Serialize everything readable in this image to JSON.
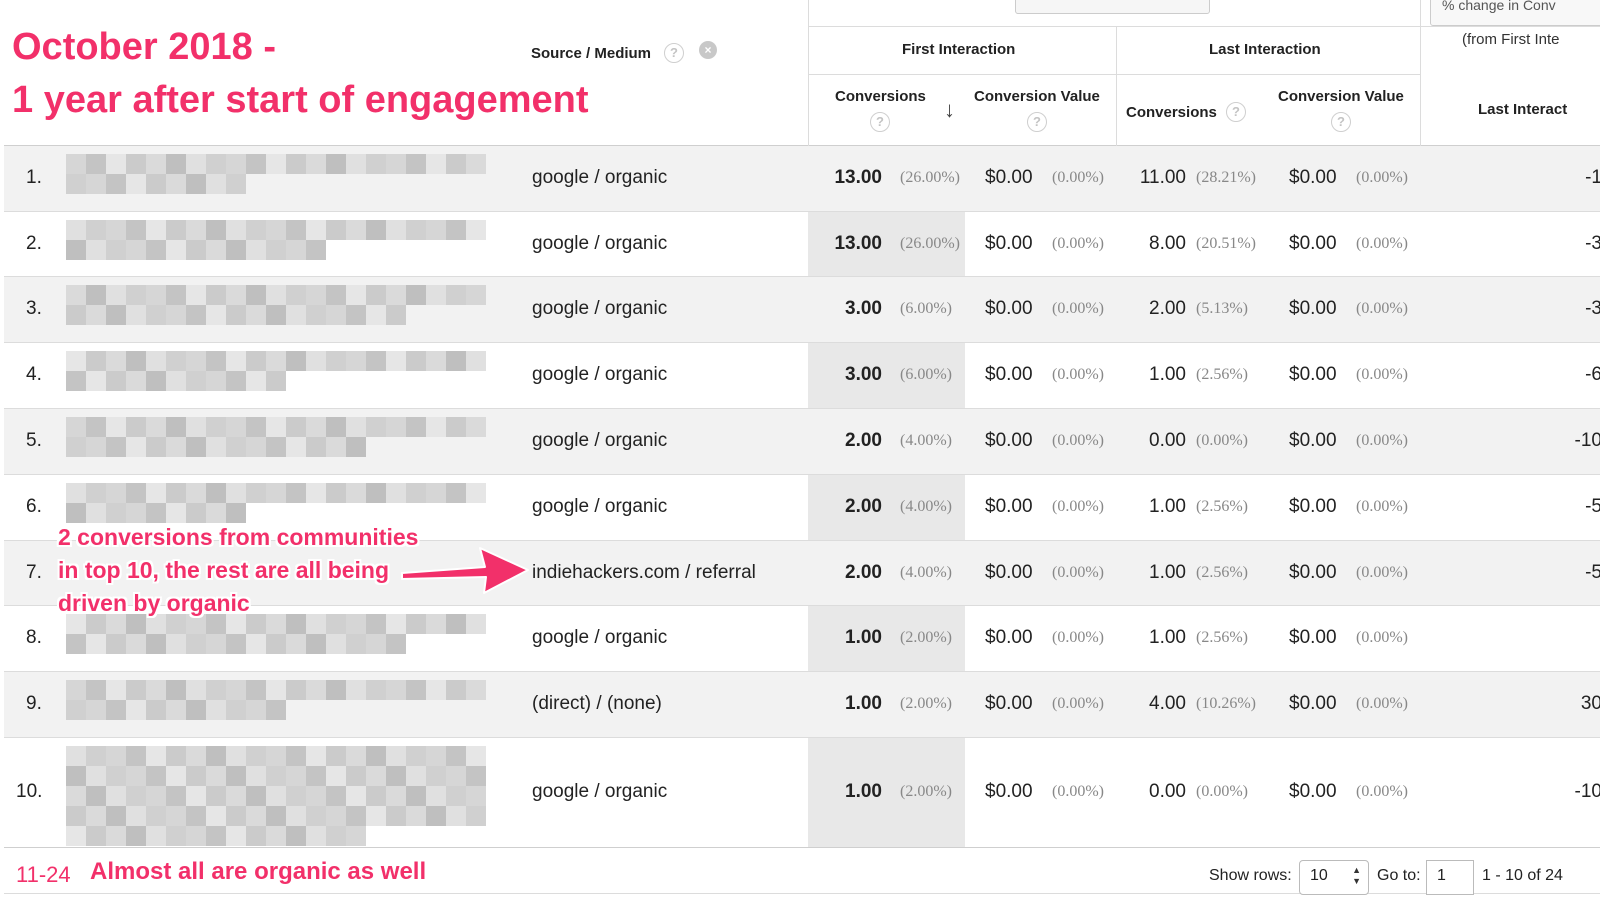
{
  "annotation": {
    "title_line1": "October 2018 -",
    "title_line2": "1 year after start of engagement",
    "note_line1": "2 conversions from communities",
    "note_line2": "in top 10, the rest are all being",
    "note_line3": "driven by organic",
    "footer_note": "Almost all are organic as well",
    "accent_color": "#f2306a"
  },
  "header": {
    "source_medium": "Source / Medium",
    "first_interaction": "First Interaction",
    "last_interaction": "Last Interaction",
    "pct_change_line1": "% change in Conv",
    "pct_change_line2": "(from First Inte",
    "fi_conversions": "Conversions",
    "fi_conversion_value": "Conversion Value",
    "li_conversions": "Conversions",
    "li_conversion_value": "Conversion Value",
    "last_interact": "Last Interact",
    "help_glyph": "?",
    "sort_glyph": "↓",
    "remove_glyph": "×"
  },
  "rows": [
    {
      "idx": "1.",
      "source": "google / organic",
      "fi_conv": "13.00",
      "fi_pct": "(26.00%)",
      "fi_val": "$0.00",
      "fi_val_pct": "(0.00%)",
      "li_conv": "11.00",
      "li_pct": "(28.21%)",
      "li_val": "$0.00",
      "li_val_pct": "(0.00%)",
      "change": "-1"
    },
    {
      "idx": "2.",
      "source": "google / organic",
      "fi_conv": "13.00",
      "fi_pct": "(26.00%)",
      "fi_val": "$0.00",
      "fi_val_pct": "(0.00%)",
      "li_conv": "8.00",
      "li_pct": "(20.51%)",
      "li_val": "$0.00",
      "li_val_pct": "(0.00%)",
      "change": "-3"
    },
    {
      "idx": "3.",
      "source": "google / organic",
      "fi_conv": "3.00",
      "fi_pct": "(6.00%)",
      "fi_val": "$0.00",
      "fi_val_pct": "(0.00%)",
      "li_conv": "2.00",
      "li_pct": "(5.13%)",
      "li_val": "$0.00",
      "li_val_pct": "(0.00%)",
      "change": "-3"
    },
    {
      "idx": "4.",
      "source": "google / organic",
      "fi_conv": "3.00",
      "fi_pct": "(6.00%)",
      "fi_val": "$0.00",
      "fi_val_pct": "(0.00%)",
      "li_conv": "1.00",
      "li_pct": "(2.56%)",
      "li_val": "$0.00",
      "li_val_pct": "(0.00%)",
      "change": "-6"
    },
    {
      "idx": "5.",
      "source": "google / organic",
      "fi_conv": "2.00",
      "fi_pct": "(4.00%)",
      "fi_val": "$0.00",
      "fi_val_pct": "(0.00%)",
      "li_conv": "0.00",
      "li_pct": "(0.00%)",
      "li_val": "$0.00",
      "li_val_pct": "(0.00%)",
      "change": "-10"
    },
    {
      "idx": "6.",
      "source": "google / organic",
      "fi_conv": "2.00",
      "fi_pct": "(4.00%)",
      "fi_val": "$0.00",
      "fi_val_pct": "(0.00%)",
      "li_conv": "1.00",
      "li_pct": "(2.56%)",
      "li_val": "$0.00",
      "li_val_pct": "(0.00%)",
      "change": "-5"
    },
    {
      "idx": "7.",
      "source": "indiehackers.com / referral",
      "fi_conv": "2.00",
      "fi_pct": "(4.00%)",
      "fi_val": "$0.00",
      "fi_val_pct": "(0.00%)",
      "li_conv": "1.00",
      "li_pct": "(2.56%)",
      "li_val": "$0.00",
      "li_val_pct": "(0.00%)",
      "change": "-5"
    },
    {
      "idx": "8.",
      "source": "google / organic",
      "fi_conv": "1.00",
      "fi_pct": "(2.00%)",
      "fi_val": "$0.00",
      "fi_val_pct": "(0.00%)",
      "li_conv": "1.00",
      "li_pct": "(2.56%)",
      "li_val": "$0.00",
      "li_val_pct": "(0.00%)",
      "change": ""
    },
    {
      "idx": "9.",
      "source": "(direct) / (none)",
      "fi_conv": "1.00",
      "fi_pct": "(2.00%)",
      "fi_val": "$0.00",
      "fi_val_pct": "(0.00%)",
      "li_conv": "4.00",
      "li_pct": "(10.26%)",
      "li_val": "$0.00",
      "li_val_pct": "(0.00%)",
      "change": "30"
    },
    {
      "idx": "10.",
      "source": "google / organic",
      "fi_conv": "1.00",
      "fi_pct": "(2.00%)",
      "fi_val": "$0.00",
      "fi_val_pct": "(0.00%)",
      "li_conv": "0.00",
      "li_pct": "(0.00%)",
      "li_val": "$0.00",
      "li_val_pct": "(0.00%)",
      "change": "-10"
    }
  ],
  "footer": {
    "range_label": "11-24",
    "show_rows_label": "Show rows:",
    "show_rows_value": "10",
    "goto_label": "Go to:",
    "goto_value": "1",
    "pagination": "1 - 10 of 24"
  }
}
